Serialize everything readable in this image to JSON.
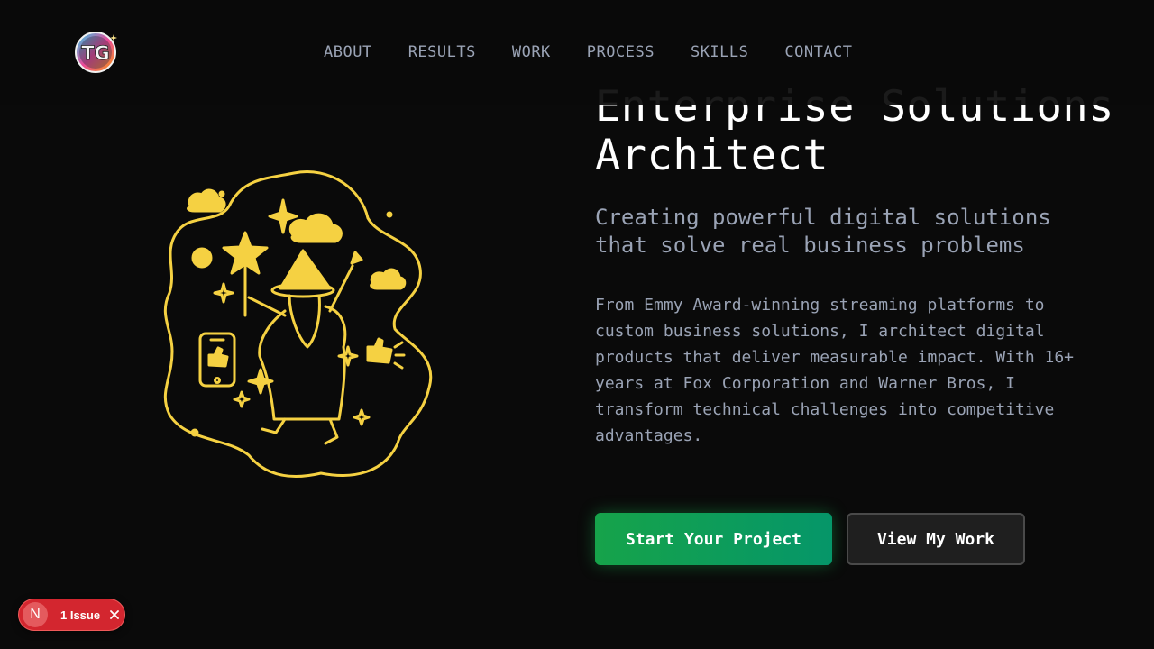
{
  "header": {
    "logo_text": "TG",
    "nav": [
      "ABOUT",
      "RESULTS",
      "WORK",
      "PROCESS",
      "SKILLS",
      "CONTACT"
    ]
  },
  "hero": {
    "title_line1": "Enterprise Solutions",
    "title_line2": "Architect",
    "subtitle": "Creating powerful digital solutions that solve real business problems",
    "body": "From Emmy Award-winning streaming platforms to custom business solutions, I architect digital products that deliver measurable impact. With 16+ years at Fox Corporation and Warner Bros, I transform technical challenges into competitive advantages.",
    "primary_cta": "Start Your Project",
    "secondary_cta": "View My Work"
  },
  "illustration": {
    "icon": "wizard-illustration",
    "color": "#f5d142"
  },
  "dev_badge": {
    "letter": "N",
    "label": "1 Issue",
    "color": "#d3262f"
  },
  "colors": {
    "background": "#0a0a0a",
    "muted_text": "#9aa3b5",
    "accent_green": "#16a34a"
  }
}
